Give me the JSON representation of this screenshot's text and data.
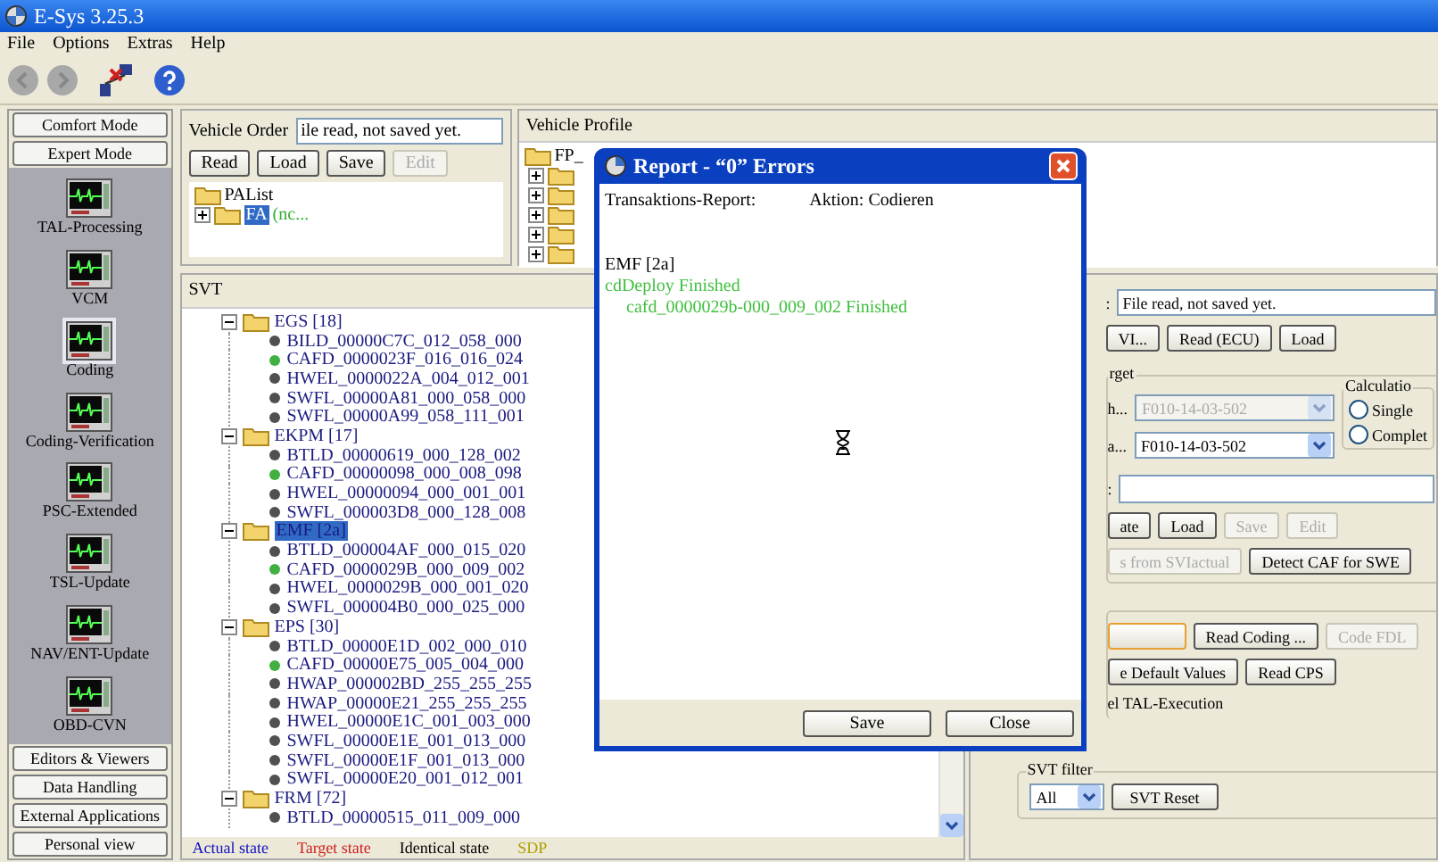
{
  "window": {
    "title": "E-Sys 3.25.3"
  },
  "menu": [
    "File",
    "Options",
    "Extras",
    "Help"
  ],
  "sidebar": {
    "top_buttons": [
      "Comfort Mode",
      "Expert Mode"
    ],
    "items": [
      {
        "label": "TAL-Processing",
        "selected": false
      },
      {
        "label": "VCM",
        "selected": false
      },
      {
        "label": "Coding",
        "selected": true
      },
      {
        "label": "Coding-Verification",
        "selected": false
      },
      {
        "label": "PSC-Extended",
        "selected": false
      },
      {
        "label": "TSL-Update",
        "selected": false
      },
      {
        "label": "NAV/ENT-Update",
        "selected": false
      },
      {
        "label": "OBD-CVN",
        "selected": false
      }
    ],
    "bottom_buttons": [
      "Editors & Viewers",
      "Data Handling",
      "External Applications",
      "Personal view"
    ]
  },
  "vehicle_order": {
    "label": "Vehicle Order",
    "value": "ile read, not saved yet.",
    "buttons": [
      {
        "label": "Read",
        "disabled": false
      },
      {
        "label": "Load",
        "disabled": false
      },
      {
        "label": "Save",
        "disabled": false
      },
      {
        "label": "Edit",
        "disabled": true
      }
    ],
    "tree": {
      "label": "PAList",
      "children": [
        {
          "label": "FA",
          "note": "(nc...",
          "selected": true,
          "expanded": false
        }
      ]
    }
  },
  "vehicle_profile": {
    "title": "Vehicle Profile",
    "tree": {
      "label": "FP_",
      "children": [
        {
          "expanded": false
        },
        {
          "expanded": false
        },
        {
          "expanded": false
        },
        {
          "expanded": false
        },
        {
          "expanded": false
        }
      ]
    }
  },
  "svt": {
    "title": "SVT",
    "groups": [
      {
        "label": "EGS [18]",
        "expanded": true,
        "selected": false,
        "children": [
          {
            "label": "BILD_00000C7C_012_058_000",
            "color": "#505050"
          },
          {
            "label": "CAFD_0000023F_016_016_024",
            "color": "#40b040"
          },
          {
            "label": "HWEL_0000022A_004_012_001",
            "color": "#505050"
          },
          {
            "label": "SWFL_00000A81_000_058_000",
            "color": "#505050"
          },
          {
            "label": "SWFL_00000A99_058_111_001",
            "color": "#505050"
          }
        ]
      },
      {
        "label": "EKPM [17]",
        "expanded": true,
        "selected": false,
        "children": [
          {
            "label": "BTLD_00000619_000_128_002",
            "color": "#505050"
          },
          {
            "label": "CAFD_00000098_000_008_098",
            "color": "#40b040"
          },
          {
            "label": "HWEL_00000094_000_001_001",
            "color": "#505050"
          },
          {
            "label": "SWFL_000003D8_000_128_008",
            "color": "#505050"
          }
        ]
      },
      {
        "label": "EMF [2a]",
        "expanded": true,
        "selected": true,
        "children": [
          {
            "label": "BTLD_000004AF_000_015_020",
            "color": "#505050"
          },
          {
            "label": "CAFD_0000029B_000_009_002",
            "color": "#40b040"
          },
          {
            "label": "HWEL_0000029B_000_001_020",
            "color": "#505050"
          },
          {
            "label": "SWFL_000004B0_000_025_000",
            "color": "#505050"
          }
        ]
      },
      {
        "label": "EPS [30]",
        "expanded": true,
        "selected": false,
        "children": [
          {
            "label": "BTLD_00000E1D_002_000_010",
            "color": "#505050"
          },
          {
            "label": "CAFD_00000E75_005_004_000",
            "color": "#40b040"
          },
          {
            "label": "HWAP_000002BD_255_255_255",
            "color": "#505050"
          },
          {
            "label": "HWAP_00000E21_255_255_255",
            "color": "#505050"
          },
          {
            "label": "HWEL_00000E1C_001_003_000",
            "color": "#505050"
          },
          {
            "label": "SWFL_00000E1E_001_013_000",
            "color": "#505050"
          },
          {
            "label": "SWFL_00000E1F_001_013_000",
            "color": "#505050"
          },
          {
            "label": "SWFL_00000E20_001_012_001",
            "color": "#505050"
          }
        ]
      },
      {
        "label": "FRM [72]",
        "expanded": true,
        "selected": false,
        "children": [
          {
            "label": "BTLD_00000515_011_009_000",
            "color": "#505050"
          }
        ]
      }
    ],
    "legend": [
      {
        "label": "Actual state",
        "color": "#1010c0"
      },
      {
        "label": "Target state",
        "color": "#d02020"
      },
      {
        "label": "Identical state",
        "color": "#000000"
      },
      {
        "label": "SDP",
        "color": "#b0a000"
      }
    ]
  },
  "dialog": {
    "title": "Report - “0” Errors",
    "header_left": "Transaktions-Report:",
    "header_right": "Aktion: Codieren",
    "lines": [
      {
        "text": "EMF [2a]",
        "kind": "plain"
      },
      {
        "text": "cdDeploy Finished",
        "kind": "success"
      },
      {
        "text": "cafd_0000029b-000_009_002 Finished",
        "kind": "success_indented"
      }
    ],
    "buttons": [
      "Save",
      "Close"
    ]
  },
  "svt_actual": {
    "label": ":",
    "value": "File read, not saved yet.",
    "buttons": [
      {
        "label": "VI...",
        "disabled": false
      },
      {
        "label": "Read (ECU)",
        "disabled": false
      },
      {
        "label": "Load",
        "disabled": false
      }
    ]
  },
  "target": {
    "title": "rget",
    "selects": [
      {
        "label": "h...",
        "value": "F010-14-03-502",
        "disabled": true
      },
      {
        "label": "a...",
        "value": "F010-14-03-502",
        "disabled": false
      }
    ],
    "calculation": {
      "title": "Calculatio",
      "options": [
        {
          "label": "Single",
          "selected": false
        },
        {
          "label": "Complet",
          "selected": false
        }
      ]
    },
    "name_label": ":",
    "buttons": [
      {
        "label": "ate",
        "disabled": false
      },
      {
        "label": "Load",
        "disabled": false
      },
      {
        "label": "Save",
        "disabled": true
      },
      {
        "label": "Edit",
        "disabled": true
      }
    ],
    "buttons2": [
      {
        "label": "s from SVIactual",
        "disabled": true
      },
      {
        "label": "Detect CAF for SWE",
        "disabled": false
      }
    ]
  },
  "coding": {
    "buttons": [
      {
        "label": "Read Coding ...",
        "disabled": false
      },
      {
        "label": "Code FDL",
        "disabled": true
      }
    ],
    "buttons2": [
      {
        "label": "e Default Values",
        "disabled": false
      },
      {
        "label": "Read CPS",
        "disabled": false
      }
    ],
    "option": "el TAL-Execution"
  },
  "svt_filter": {
    "title": "SVT filter",
    "value": "All",
    "button": "SVT Reset"
  }
}
